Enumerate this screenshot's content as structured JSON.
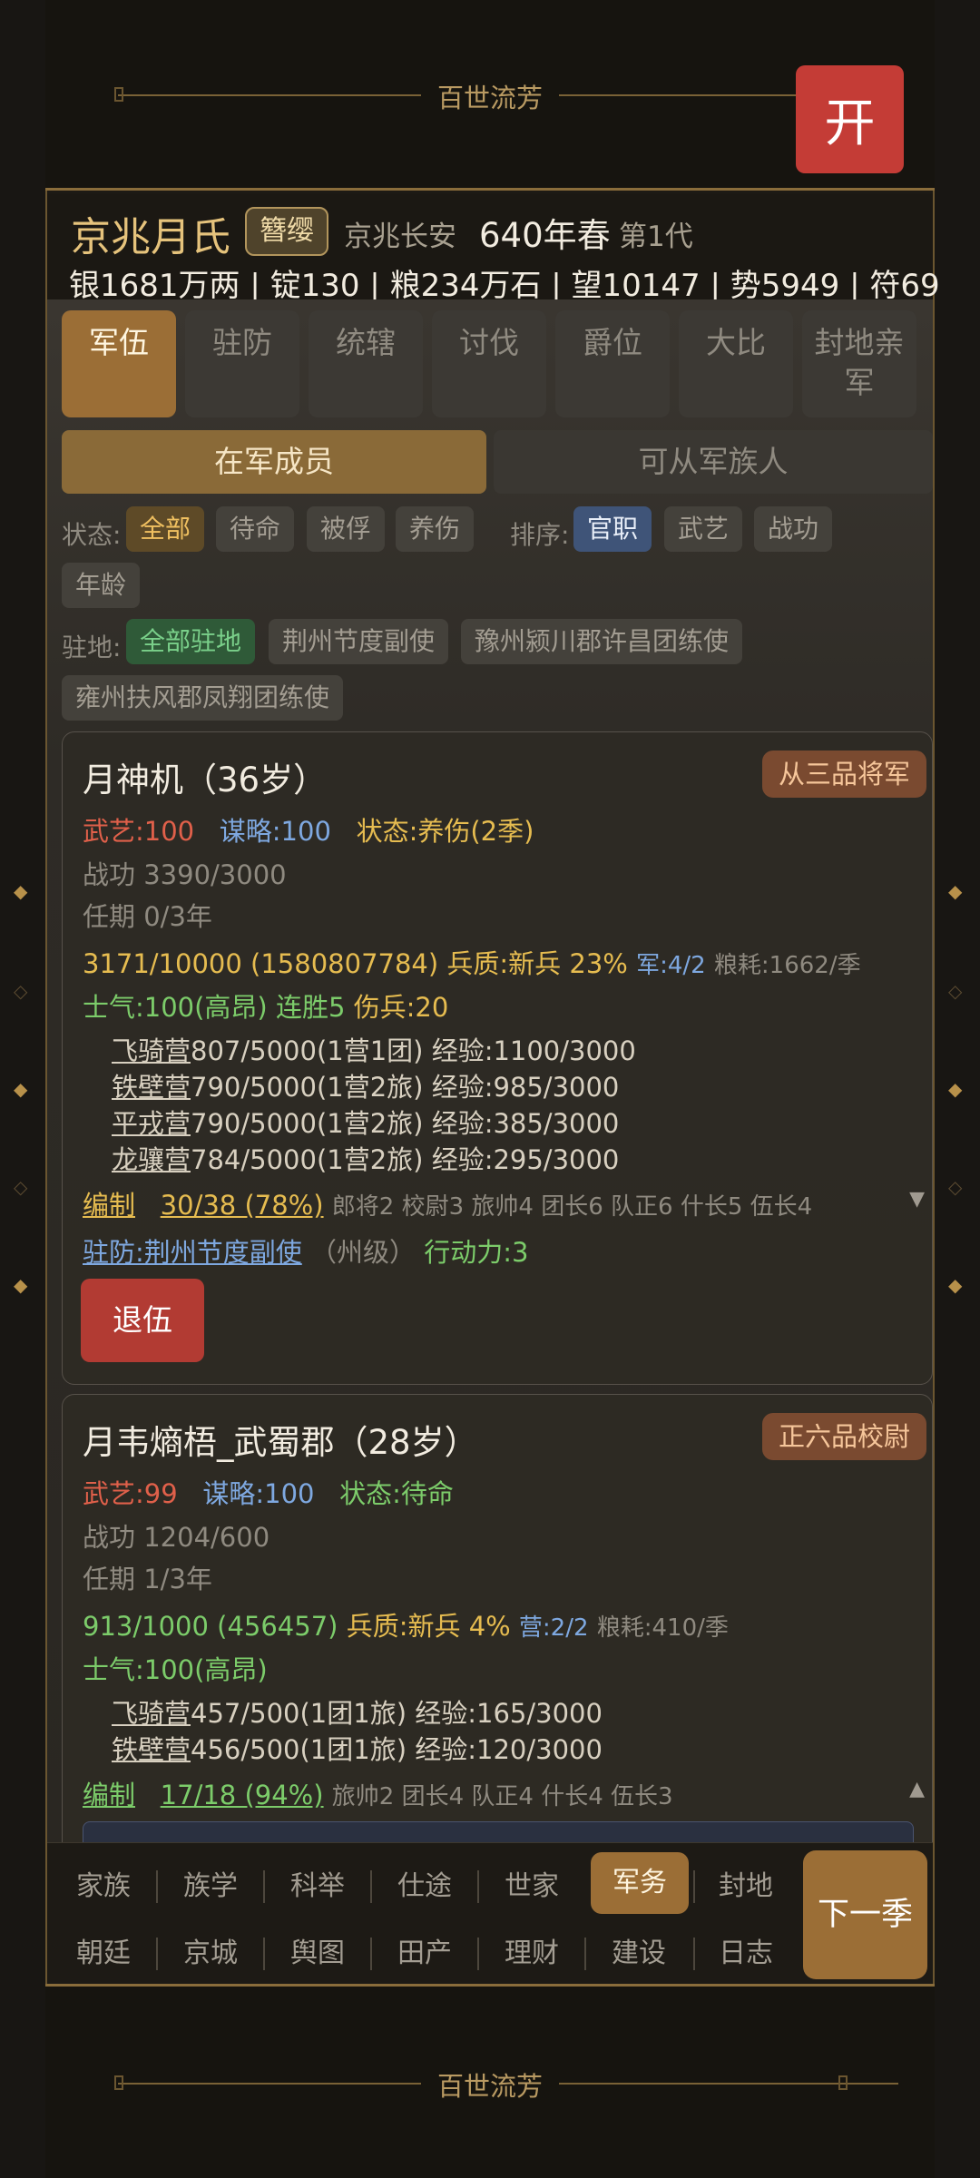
{
  "top_banner": {
    "title": "百世流芳",
    "open_button": "开"
  },
  "header": {
    "clan_name": "京兆月氏",
    "badge": "簪缨",
    "place": "京兆长安",
    "year": "640年春",
    "generation": "第1代",
    "resources": "银1681万两 | 锭130 | 粮234万石 | 望10147 | 势5949 | 符69"
  },
  "tabs": [
    {
      "label": "军伍"
    },
    {
      "label": "驻防"
    },
    {
      "label": "统辖"
    },
    {
      "label": "讨伐"
    },
    {
      "label": "爵位"
    },
    {
      "label": "大比"
    },
    {
      "label": "封地亲军"
    }
  ],
  "segments": {
    "left": "在军成员",
    "right": "可从军族人"
  },
  "filters": {
    "status_label": "状态:",
    "status": [
      "全部",
      "待命",
      "被俘",
      "养伤"
    ],
    "sort_label": "排序:",
    "sort": [
      "官职",
      "武艺",
      "战功",
      "年龄"
    ],
    "station_label": "驻地:",
    "stations": [
      "全部驻地",
      "荆州节度副使",
      "豫州颍川郡许昌团练使",
      "雍州扶风郡凤翔团练使"
    ]
  },
  "cards": [
    {
      "name": "月神机（36岁）",
      "rank": "从三品将军",
      "martial": "武艺:100",
      "strategy": "谋略:100",
      "status": "状态:养伤(2季)",
      "merit": "战功 3390/3000",
      "term": "任期 0/3年",
      "troops": "3171/10000 (1580807784)",
      "quality": "兵质:新兵 23%",
      "army": "军:4/2",
      "grain": "粮耗:1662/季",
      "morale": "士气:100(高昂)",
      "streak": "连胜5",
      "wounded": "伤兵:20",
      "units": [
        {
          "name": "飞骑营",
          "info": "807/5000(1营1团) 经验:1100/3000"
        },
        {
          "name": "铁壁营",
          "info": "790/5000(1营2旅) 经验:985/3000"
        },
        {
          "name": "平戎营",
          "info": "790/5000(1营2旅) 经验:385/3000"
        },
        {
          "name": "龙骧营",
          "info": "784/5000(1营2旅) 经验:295/3000"
        }
      ],
      "org_label": "编制",
      "org_value": "30/38 (78%)",
      "org_detail": "郎将2 校尉3 旅帅4 团长6 队正6 什长5 伍长4",
      "org_caret": "▼",
      "garrison": "驻防:荆州节度副使",
      "garrison_level": "（州级）",
      "action": "行动力:3",
      "retire": "退伍"
    },
    {
      "name": "月韦熵梧_武蜀郡（28岁）",
      "rank": "正六品校尉",
      "martial": "武艺:99",
      "strategy": "谋略:100",
      "status": "状态:待命",
      "merit": "战功 1204/600",
      "term": "任期 1/3年",
      "troops": "913/1000 (456457)",
      "quality": "兵质:新兵 4%",
      "army": "营:2/2",
      "grain": "粮耗:410/季",
      "morale": "士气:100(高昂)",
      "units": [
        {
          "name": "飞骑营",
          "info": "457/500(1团1旅) 经验:165/3000"
        },
        {
          "name": "铁壁营",
          "info": "456/500(1团1旅) 经验:120/3000"
        }
      ],
      "org_label": "编制",
      "org_value": "17/18 (94%)",
      "org_detail": "旅帅2 团长4 队正4 什长4 伍长3",
      "org_caret": "▲"
    }
  ],
  "nav": {
    "row1": [
      "家族",
      "族学",
      "科举",
      "仕途",
      "世家",
      "军务",
      "封地"
    ],
    "row2": [
      "朝廷",
      "京城",
      "舆图",
      "田产",
      "理财",
      "建设",
      "日志"
    ],
    "next": "下一季"
  },
  "bottom_banner": {
    "title": "百世流芳"
  }
}
